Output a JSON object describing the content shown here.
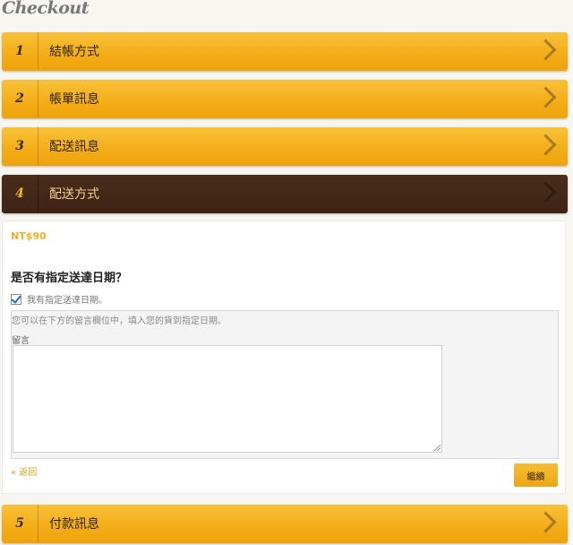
{
  "page": {
    "title": "Checkout"
  },
  "steps": [
    {
      "number": "1",
      "label": "結帳方式"
    },
    {
      "number": "2",
      "label": "帳單訊息"
    },
    {
      "number": "3",
      "label": "配送訊息"
    },
    {
      "number": "4",
      "label": "配送方式"
    },
    {
      "number": "5",
      "label": "付款訊息"
    }
  ],
  "shipping": {
    "price": "NT$90",
    "question": "是否有指定送達日期？",
    "checkbox_label": "我有指定送達日期。",
    "checkbox_checked": true,
    "hint": "您可以在下方的留言欄位中，填入您的貨到指定日期。",
    "comment_label": "留言",
    "comment_value": "",
    "back_label": "« 返回",
    "continue_label": "繼續"
  },
  "colors": {
    "accent": "#f3ac16",
    "active_step": "#3e2415",
    "price": "#f0b22a"
  }
}
